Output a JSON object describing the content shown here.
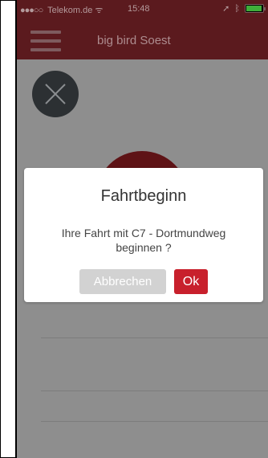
{
  "status_bar": {
    "carrier": "Telekom.de",
    "time": "15:48",
    "signal_icon": "signal-dots-icon",
    "wifi_icon": "wifi-icon",
    "location_icon": "location-arrow-icon",
    "bluetooth_icon": "bluetooth-icon",
    "battery_icon": "battery-icon"
  },
  "header": {
    "title": "big bird Soest",
    "menu_icon": "hamburger-menu-icon"
  },
  "main": {
    "close_icon": "close-icon"
  },
  "dialog": {
    "title": "Fahrtbeginn",
    "message": "Ihre Fahrt mit C7 - Dortmundweg beginnen ?",
    "cancel_label": "Abbrechen",
    "ok_label": "Ok"
  },
  "colors": {
    "header_bg": "#5b1a1e",
    "overlay_bg": "#8e8e8e",
    "ok_button": "#c8202c",
    "cancel_button": "#d2d2d2"
  }
}
